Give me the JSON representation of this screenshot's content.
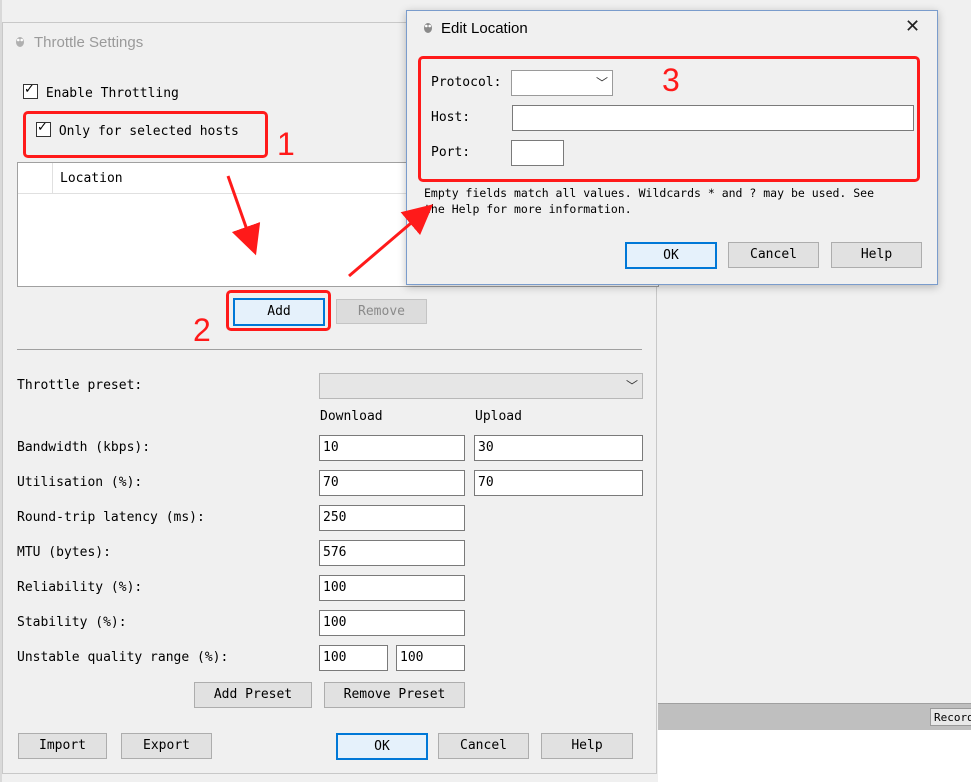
{
  "throttle_dialog": {
    "title": "Throttle Settings",
    "enable_throttling_label": "Enable Throttling",
    "only_selected_hosts_label": "Only for selected hosts",
    "location_column": "Location",
    "add_button": "Add",
    "remove_button": "Remove",
    "throttle_preset_label": "Throttle preset:",
    "throttle_preset_value": "",
    "download_header": "Download",
    "upload_header": "Upload",
    "rows": {
      "bandwidth": {
        "label": "Bandwidth (kbps):",
        "download": "10",
        "upload": "30"
      },
      "utilisation": {
        "label": "Utilisation (%):",
        "download": "70",
        "upload": "70"
      },
      "latency": {
        "label": "Round-trip latency (ms):",
        "value": "250"
      },
      "mtu": {
        "label": "MTU (bytes):",
        "value": "576"
      },
      "reliability": {
        "label": "Reliability (%):",
        "value": "100"
      },
      "stability": {
        "label": "Stability (%):",
        "value": "100"
      },
      "unstable_range": {
        "label": "Unstable quality range (%):",
        "min": "100",
        "max": "100"
      }
    },
    "add_preset_button": "Add Preset",
    "remove_preset_button": "Remove Preset",
    "import_button": "Import",
    "export_button": "Export",
    "ok_button": "OK",
    "cancel_button": "Cancel",
    "help_button": "Help"
  },
  "edit_location_dialog": {
    "title": "Edit Location",
    "protocol_label": "Protocol:",
    "protocol_value": "",
    "host_label": "Host:",
    "host_value": "",
    "port_label": "Port:",
    "port_value": "",
    "info_line1": "Empty fields match all values. Wildcards * and ? may be used. See",
    "info_line2": "the Help for more information.",
    "ok_button": "OK",
    "cancel_button": "Cancel",
    "help_button": "Help"
  },
  "background": {
    "record_button": "Record"
  },
  "annotations": {
    "step1": "1",
    "step2": "2",
    "step3": "3",
    "color": "#ff1a1a"
  }
}
